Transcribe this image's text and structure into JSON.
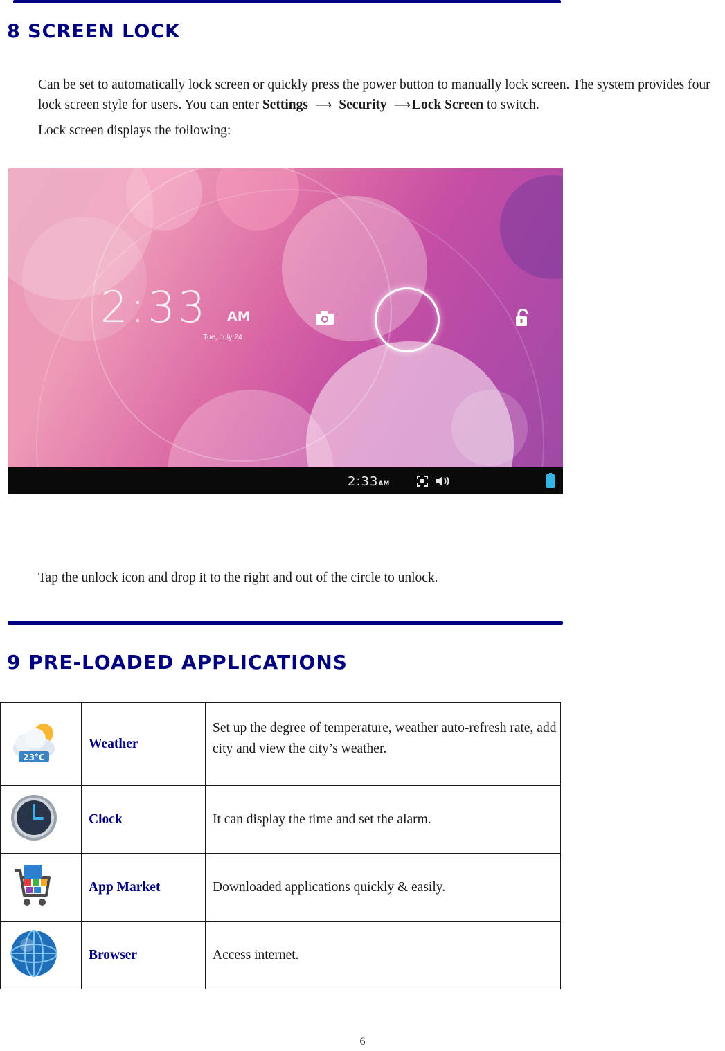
{
  "section8": {
    "title": "8 SCREEN LOCK",
    "para1_a": "Can be set to automatically lock screen or quickly press the power button to manually lock screen. The system provides four lock screen style for users. You can enter ",
    "path_settings": "Settings",
    "path_security": "Security",
    "path_lock_screen": "Lock Screen",
    "para1_b": " to switch.",
    "para2": "Lock screen displays the following:",
    "lockscreen": {
      "time": "2:33",
      "ampm": "AM",
      "date": "Tue, July 24",
      "status_time": "2:33",
      "status_ampm": "AM",
      "camera_icon": "camera-icon",
      "unlock_icon": "unlock-icon"
    },
    "caption": "Tap the unlock icon and drop it to the right and out of the circle to unlock."
  },
  "section9": {
    "title": "9 PRE-LOADED APPLICATIONS",
    "apps": [
      {
        "icon": "weather-icon",
        "icon_text": "23°C",
        "name": "Weather",
        "description": "Set up the degree of temperature, weather auto-refresh rate, add city and view the city’s weather."
      },
      {
        "icon": "clock-icon",
        "name": "Clock",
        "description": "It can display the time and set the alarm."
      },
      {
        "icon": "app-market-icon",
        "name": "App Market",
        "description": "Downloaded applications quickly & easily."
      },
      {
        "icon": "browser-icon",
        "name": "Browser",
        "description": "Access internet."
      }
    ]
  },
  "page_number": "6",
  "colors": {
    "heading": "#000080",
    "rule": "#000080"
  }
}
